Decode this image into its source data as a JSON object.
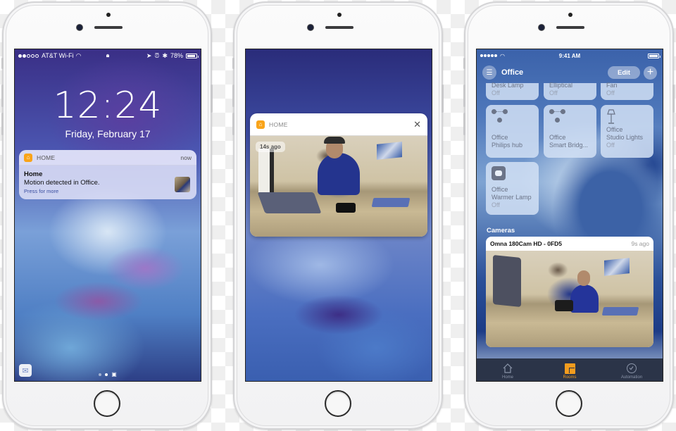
{
  "colors": {
    "accent_orange": "#f39c1e",
    "home_app_icon": "#f9a41a",
    "tab_bar_bg": "#2b3448",
    "link_blue": "#3a4ea0"
  },
  "phone1": {
    "status_bar": {
      "carrier": "AT&T Wi-Fi",
      "signal_bars_filled": 2,
      "signal_bars_total": 5,
      "center_icon": "lock-icon",
      "battery_percent": "78%",
      "battery_level": 0.78,
      "right_icons": [
        "location-icon",
        "alarm-icon",
        "bluetooth-icon"
      ]
    },
    "clock": "12:24",
    "date": "Friday, February 17",
    "notification": {
      "app": "HOME",
      "time": "now",
      "title": "Home",
      "body": "Motion detected in Office.",
      "more": "Press for more"
    },
    "page_indicator": {
      "pages": 2,
      "current": 2,
      "camera_icon": "camera-icon"
    },
    "corner_icon": "mail-icon"
  },
  "phone2": {
    "card": {
      "app": "HOME",
      "close_icon": "close-icon",
      "badge": "14s ago"
    }
  },
  "phone3": {
    "status_bar": {
      "time": "9:41 AM",
      "signal_bars_filled": 5
    },
    "nav": {
      "title": "Office",
      "edit": "Edit",
      "add": "+"
    },
    "tiles_partial": [
      {
        "name": "Desk Lamp",
        "state": "Off"
      },
      {
        "name": "Elliptical",
        "state": "Off"
      },
      {
        "name": "Fan",
        "state": "Off"
      }
    ],
    "tiles": [
      {
        "room": "Office",
        "name": "Philips hub",
        "state": "",
        "icon": "hub-icon"
      },
      {
        "room": "Office",
        "name": "Smart Bridg...",
        "state": "",
        "icon": "hub-icon"
      },
      {
        "room": "Office",
        "name": "Studio Lights",
        "state": "Off",
        "icon": "lamp-icon"
      },
      {
        "room": "Office",
        "name": "Warmer Lamp",
        "state": "Off",
        "icon": "outlet-icon"
      }
    ],
    "section": "Cameras",
    "camera": {
      "name": "Omna 180Cam HD - 0FD5",
      "time": "9s ago"
    },
    "tabs": [
      {
        "label": "Home",
        "active": false
      },
      {
        "label": "Rooms",
        "active": true
      },
      {
        "label": "Automation",
        "active": false
      }
    ]
  }
}
